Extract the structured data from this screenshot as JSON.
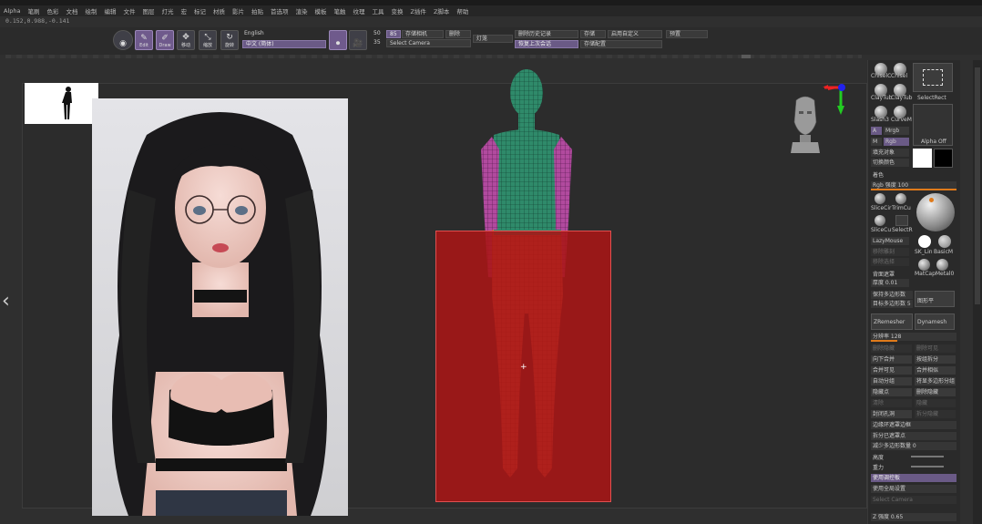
{
  "menu": [
    "Alpha",
    "笔刷",
    "色彩",
    "文档",
    "绘制",
    "编辑",
    "文件",
    "图层",
    "灯光",
    "宏",
    "标记",
    "材质",
    "影片",
    "拍贴",
    "首选项",
    "渲染",
    "模板",
    "笔触",
    "纹理",
    "工具",
    "变换",
    "Z插件",
    "Z脚本",
    "帮助"
  ],
  "coords": "0.152,0.988,-0.141",
  "toolbar": {
    "icons": [
      {
        "name": "edit-tool",
        "glyph": "✎",
        "label": "Edit",
        "active": true
      },
      {
        "name": "draw-tool",
        "glyph": "✐",
        "label": "Draw",
        "active": true
      },
      {
        "name": "move-tool",
        "glyph": "✥",
        "label": "移动",
        "active": false
      },
      {
        "name": "scale-tool",
        "glyph": "⤡",
        "label": "缩放",
        "active": false
      },
      {
        "name": "rotate-tool",
        "glyph": "↻",
        "label": "旋转",
        "active": false
      },
      {
        "name": "floor-tool",
        "glyph": "▦",
        "label": "地面网格",
        "active": false
      }
    ],
    "lang_label": "English",
    "lang_selected": "中文 (简体)",
    "num_top": "50",
    "num_bottom": "35",
    "btn_85": "85",
    "save_camera": "存储相机",
    "delete": "删除",
    "select_camera": "Select Camera",
    "light": "灯笼",
    "history_delete": "删除历史记录",
    "store": "存储",
    "custom_ui": "启用自定义",
    "recent": "恢复上次会话",
    "store_config": "存储配置",
    "preset": "预置"
  },
  "right_panel": {
    "brushes_top": [
      "ChiselC",
      "Chisel"
    ],
    "select_rect": "SelectRect",
    "clay_row": [
      "ClayTub",
      "ClayTub"
    ],
    "slash_row": [
      "Slash3",
      "CurveM"
    ],
    "a_label": "A",
    "mrgb": "Mrgb",
    "m_label": "M",
    "rgb": "Rgb",
    "alpha_off": "Alpha Off",
    "fill_object": "填充对象",
    "switch_color": "切换颜色",
    "color": "着色",
    "rgb_intensity": "Rgb 强度 100",
    "rgb_intensity_value": 100,
    "slice_row": [
      "SliceCir",
      "TrimCu"
    ],
    "slice_row2": [
      "SliceCu",
      "SelectR"
    ],
    "lazymouse": "LazyMouse",
    "sk_label": "SK_Lin",
    "basic_mat": "BasicM",
    "dim1": "移除雕刻",
    "dim2": "移除选择",
    "matcap": "MatCapMetal0",
    "thickness_label": "背面遮罩",
    "thickness_value": "厚度 0.01",
    "keep_polycount": "保持多边形数",
    "subdivide": "图形平",
    "target_poly": "目标多边形数 5",
    "zremesher": "ZRemesher",
    "dynamesh": "Dynamesh",
    "resolution": "分辨率 128",
    "resolution_value": 128,
    "dim_pair1": [
      "删除隐藏",
      "删除可见"
    ],
    "pair2": [
      "向下合并",
      "按组拆分"
    ],
    "pair3": [
      "合并可见",
      "合并相似"
    ],
    "pair4": [
      "自动分组",
      "将显多边形分组"
    ],
    "pair5": [
      "隐藏点",
      "删除隐藏"
    ],
    "dim_pair6": [
      "清除",
      "隐藏"
    ],
    "pair7": [
      "封闭孔洞",
      "拆分隐藏"
    ],
    "row_edge": "边缘环遮罩边框",
    "row_split": "拆分已遮罩点",
    "row_subdiv": "减少多边形数量 0",
    "row_strength": "高度",
    "row_gravity": "重力",
    "highlight": "使用调控板",
    "use_all": "使用全局设置",
    "select_camera": "Select Camera",
    "z_strength": "Z 强度 0.65"
  }
}
